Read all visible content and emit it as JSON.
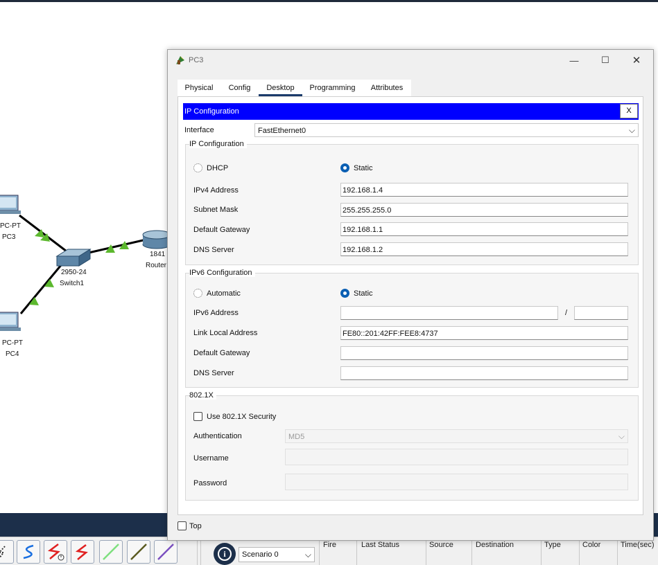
{
  "window": {
    "title": "PC3",
    "minimize": "—",
    "maximize": "☐",
    "close": "✕"
  },
  "tabs": [
    {
      "label": "Physical"
    },
    {
      "label": "Config"
    },
    {
      "label": "Desktop",
      "active": true
    },
    {
      "label": "Programming"
    },
    {
      "label": "Attributes"
    }
  ],
  "ip_config": {
    "header_title": "IP Configuration",
    "close_label": "X",
    "interface_label": "Interface",
    "interface_value": "FastEthernet0",
    "ipv4": {
      "group_title": "IP Configuration",
      "dhcp_label": "DHCP",
      "static_label": "Static",
      "selected": "Static",
      "ipv4_address_label": "IPv4 Address",
      "ipv4_address": "192.168.1.4",
      "subnet_mask_label": "Subnet Mask",
      "subnet_mask": "255.255.255.0",
      "default_gateway_label": "Default Gateway",
      "default_gateway": "192.168.1.1",
      "dns_server_label": "DNS Server",
      "dns_server": "192.168.1.2"
    },
    "ipv6": {
      "group_title": "IPv6 Configuration",
      "automatic_label": "Automatic",
      "static_label": "Static",
      "selected": "Static",
      "ipv6_address_label": "IPv6 Address",
      "ipv6_address": "",
      "prefix_separator": "/",
      "prefix_length": "",
      "link_local_label": "Link Local Address",
      "link_local": "FE80::201:42FF:FEE8:4737",
      "default_gateway_label": "Default Gateway",
      "default_gateway": "",
      "dns_server_label": "DNS Server",
      "dns_server": ""
    },
    "dot1x": {
      "group_title": "802.1X",
      "use_security_label": "Use 802.1X Security",
      "use_security_checked": false,
      "authentication_label": "Authentication",
      "authentication_value": "MD5",
      "username_label": "Username",
      "username": "",
      "password_label": "Password",
      "password": ""
    }
  },
  "footer": {
    "top_label": "Top",
    "top_checked": false
  },
  "topology": {
    "pc3": {
      "type": "PC-PT",
      "name": "PC3"
    },
    "pc4": {
      "type": "PC-PT",
      "name": "PC4"
    },
    "switch": {
      "type": "2950-24",
      "name": "Switch1"
    },
    "router": {
      "type": "1841",
      "name": "Router"
    }
  },
  "bottom_toolbar": {
    "scenario": "Scenario 0",
    "pdu_columns": [
      "Fire",
      "Last Status",
      "Source",
      "Destination",
      "Type",
      "Color",
      "Time(sec)"
    ]
  },
  "colors": {
    "header_blue": "#0000ff",
    "radio_selected": "#0b5fb3",
    "link_green": "#5cb82e",
    "dark_strip": "#1c2f4a"
  }
}
